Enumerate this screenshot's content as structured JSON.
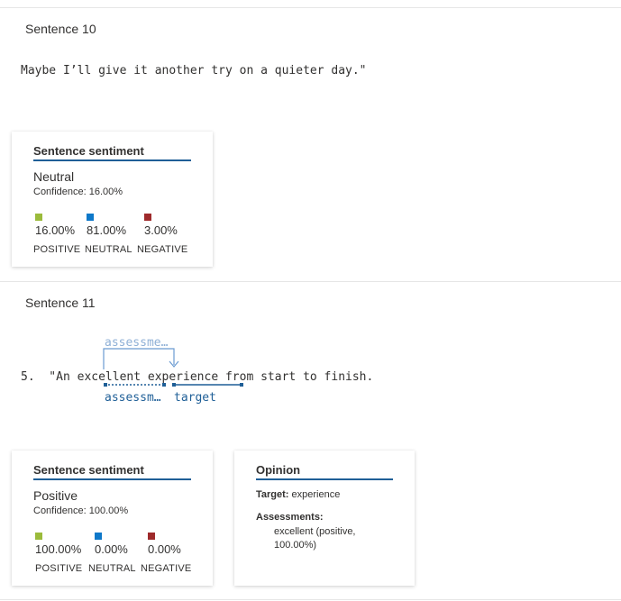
{
  "sentence10": {
    "title": "Sentence 10",
    "text": "Maybe I’ll give it another try on a quieter day.\"",
    "card": {
      "title": "Sentence sentiment",
      "label": "Neutral",
      "confidence": "Confidence: 16.00%",
      "positive_value": "16.00%",
      "neutral_value": "81.00%",
      "negative_value": "3.00%",
      "positive_caption": "POSITIVE",
      "neutral_caption": "NEUTRAL",
      "negative_caption": "NEGATIVE"
    }
  },
  "sentence11": {
    "title": "Sentence 11",
    "text": "5.  \"An excellent experience from start to finish.",
    "annotation_top": "assessme…",
    "annotation_assessment": "assessm…",
    "annotation_target": "target",
    "card": {
      "title": "Sentence sentiment",
      "label": "Positive",
      "confidence": "Confidence: 100.00%",
      "positive_value": "100.00%",
      "neutral_value": "0.00%",
      "negative_value": "0.00%",
      "positive_caption": "POSITIVE",
      "neutral_caption": "NEUTRAL",
      "negative_caption": "NEGATIVE"
    },
    "opinion": {
      "title": "Opinion",
      "target_label": "Target:",
      "target_value": "experience",
      "assessments_label": "Assessments:",
      "assessment_line1": "excellent (positive,",
      "assessment_line2": "100.00%)"
    }
  },
  "colors": {
    "positive": "#9bbb3b",
    "neutral": "#0e78c9",
    "negative": "#9e2a2b",
    "accent": "#1f5f97",
    "annotation": "#6b9bd1"
  }
}
